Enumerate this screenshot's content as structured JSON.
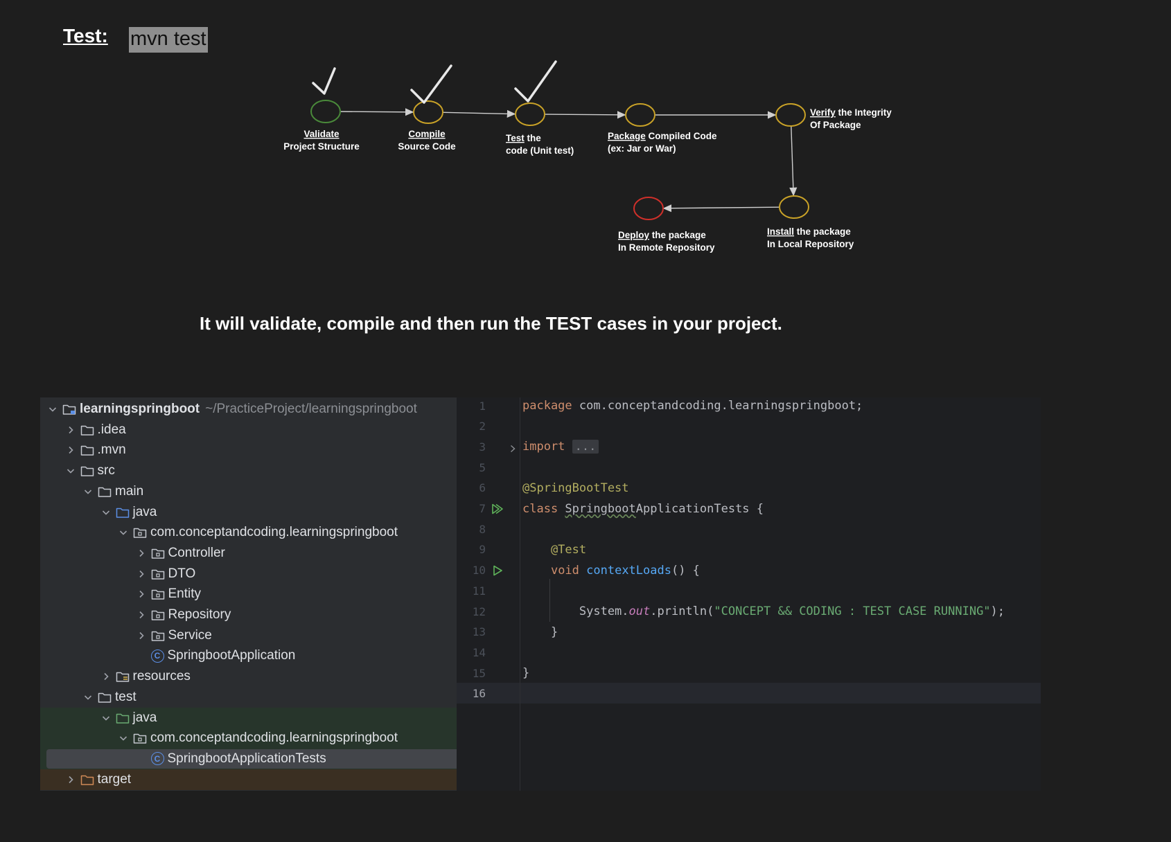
{
  "heading": {
    "label": "Test:",
    "command": "mvn test"
  },
  "lifecycle": {
    "steps": [
      {
        "id": "validate",
        "verb": "Validate",
        "line1_rest": "",
        "line2": "Project Structure",
        "done": true,
        "color": "#4a8a3a"
      },
      {
        "id": "compile",
        "verb": "Compile",
        "line1_rest": "",
        "line2": "Source Code",
        "done": true,
        "color": "#c9a227"
      },
      {
        "id": "test",
        "verb": "Test",
        "line1_rest": " the",
        "line2": "code (Unit test)",
        "done": true,
        "color": "#c9a227"
      },
      {
        "id": "package",
        "verb": "Package",
        "line1_rest": " Compiled Code",
        "line2": "(ex: Jar or War)",
        "done": false,
        "color": "#c9a227"
      },
      {
        "id": "verify",
        "verb": "Verify",
        "line1_rest": " the Integrity",
        "line2": "Of Package",
        "done": false,
        "color": "#c9a227"
      },
      {
        "id": "install",
        "verb": "Install",
        "line1_rest": " the package",
        "line2": "In Local Repository",
        "done": false,
        "color": "#c9a227"
      },
      {
        "id": "deploy",
        "verb": "Deploy",
        "line1_rest": " the package",
        "line2": "In Remote Repository",
        "done": false,
        "color": "#d0302a"
      }
    ]
  },
  "caption": "It will validate, compile and then run the TEST cases in your project.",
  "project_tree": {
    "rows": [
      {
        "label": "learningspringboot",
        "path": "~/PracticeProject/learningspringboot",
        "depth": 0,
        "chevron": "down",
        "icon": "module-folder-icon",
        "root": true,
        "band": "",
        "selected": false
      },
      {
        "label": ".idea",
        "path": "",
        "depth": 1,
        "chevron": "right",
        "icon": "folder-icon",
        "band": "",
        "selected": false
      },
      {
        "label": ".mvn",
        "path": "",
        "depth": 1,
        "chevron": "right",
        "icon": "folder-icon",
        "band": "",
        "selected": false
      },
      {
        "label": "src",
        "path": "",
        "depth": 1,
        "chevron": "down",
        "icon": "folder-icon",
        "band": "",
        "selected": false
      },
      {
        "label": "main",
        "path": "",
        "depth": 2,
        "chevron": "down",
        "icon": "folder-icon",
        "band": "",
        "selected": false
      },
      {
        "label": "java",
        "path": "",
        "depth": 3,
        "chevron": "down",
        "icon": "source-folder-icon",
        "band": "",
        "selected": false
      },
      {
        "label": "com.conceptandcoding.learningspringboot",
        "path": "",
        "depth": 4,
        "chevron": "down",
        "icon": "package-icon",
        "band": "",
        "selected": false
      },
      {
        "label": "Controller",
        "path": "",
        "depth": 5,
        "chevron": "right",
        "icon": "package-icon",
        "band": "",
        "selected": false
      },
      {
        "label": "DTO",
        "path": "",
        "depth": 5,
        "chevron": "right",
        "icon": "package-icon",
        "band": "",
        "selected": false
      },
      {
        "label": "Entity",
        "path": "",
        "depth": 5,
        "chevron": "right",
        "icon": "package-icon",
        "band": "",
        "selected": false
      },
      {
        "label": "Repository",
        "path": "",
        "depth": 5,
        "chevron": "right",
        "icon": "package-icon",
        "band": "",
        "selected": false
      },
      {
        "label": "Service",
        "path": "",
        "depth": 5,
        "chevron": "right",
        "icon": "package-icon",
        "band": "",
        "selected": false
      },
      {
        "label": "SpringbootApplication",
        "path": "",
        "depth": 5,
        "chevron": "none",
        "icon": "class-icon",
        "band": "",
        "selected": false
      },
      {
        "label": "resources",
        "path": "",
        "depth": 3,
        "chevron": "right",
        "icon": "resources-folder-icon",
        "band": "",
        "selected": false
      },
      {
        "label": "test",
        "path": "",
        "depth": 2,
        "chevron": "down",
        "icon": "folder-icon",
        "band": "",
        "selected": false
      },
      {
        "label": "java",
        "path": "",
        "depth": 3,
        "chevron": "down",
        "icon": "test-source-folder-icon",
        "band": "test",
        "selected": false
      },
      {
        "label": "com.conceptandcoding.learningspringboot",
        "path": "",
        "depth": 4,
        "chevron": "down",
        "icon": "package-icon",
        "band": "test",
        "selected": false
      },
      {
        "label": "SpringbootApplicationTests",
        "path": "",
        "depth": 5,
        "chevron": "none",
        "icon": "class-icon",
        "band": "test",
        "selected": true
      },
      {
        "label": "target",
        "path": "",
        "depth": 1,
        "chevron": "right",
        "icon": "excluded-folder-icon",
        "band": "target",
        "selected": false
      }
    ]
  },
  "editor": {
    "current_line": "16",
    "lines": [
      {
        "n": "1",
        "gutter": "",
        "tokens": [
          {
            "t": "package ",
            "c": "kw"
          },
          {
            "t": "com.conceptandcoding.learningspringboot;",
            "c": ""
          }
        ]
      },
      {
        "n": "2",
        "gutter": "",
        "tokens": []
      },
      {
        "n": "3",
        "gutter": "fold",
        "tokens": [
          {
            "t": "import ",
            "c": "kw"
          },
          {
            "t": "...",
            "c": "fold-box"
          }
        ]
      },
      {
        "n": "5",
        "gutter": "",
        "tokens": []
      },
      {
        "n": "6",
        "gutter": "",
        "tokens": [
          {
            "t": "@SpringBootTest",
            "c": "ann"
          }
        ]
      },
      {
        "n": "7",
        "gutter": "run-all",
        "tokens": [
          {
            "t": "class ",
            "c": "kw"
          },
          {
            "t": "Springboot",
            "c": "squig"
          },
          {
            "t": "ApplicationTests {",
            "c": ""
          }
        ]
      },
      {
        "n": "8",
        "gutter": "",
        "tokens": []
      },
      {
        "n": "9",
        "gutter": "",
        "tokens": [
          {
            "t": "    @Test",
            "c": "ann"
          }
        ]
      },
      {
        "n": "10",
        "gutter": "run",
        "tokens": [
          {
            "t": "    ",
            "c": ""
          },
          {
            "t": "void ",
            "c": "kw"
          },
          {
            "t": "contextLoads",
            "c": "fn"
          },
          {
            "t": "() {",
            "c": ""
          }
        ]
      },
      {
        "n": "11",
        "gutter": "",
        "tokens": []
      },
      {
        "n": "12",
        "gutter": "",
        "tokens": [
          {
            "t": "        System.",
            "c": ""
          },
          {
            "t": "out",
            "c": "fld"
          },
          {
            "t": ".println(",
            "c": ""
          },
          {
            "t": "\"CONCEPT && CODING : TEST CASE RUNNING\"",
            "c": "str"
          },
          {
            "t": ");",
            "c": ""
          }
        ]
      },
      {
        "n": "13",
        "gutter": "",
        "tokens": [
          {
            "t": "    }",
            "c": ""
          }
        ]
      },
      {
        "n": "14",
        "gutter": "",
        "tokens": []
      },
      {
        "n": "15",
        "gutter": "",
        "tokens": [
          {
            "t": "}",
            "c": ""
          }
        ]
      },
      {
        "n": "16",
        "gutter": "",
        "tokens": []
      }
    ]
  }
}
